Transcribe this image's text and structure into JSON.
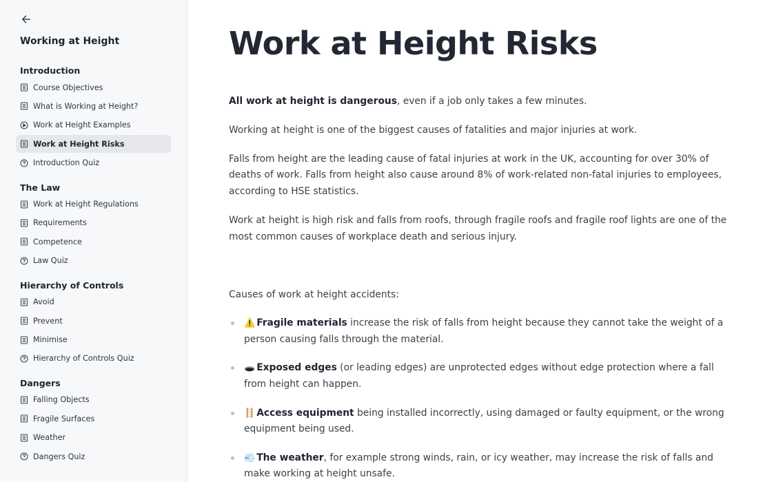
{
  "sidebar": {
    "course_title": "Working at Height",
    "sections": [
      {
        "title": "Introduction",
        "lessons": [
          {
            "label": "Course Objectives",
            "icon": "document-icon"
          },
          {
            "label": "What is Working at Height?",
            "icon": "document-icon"
          },
          {
            "label": "Work at Height Examples",
            "icon": "play-icon"
          },
          {
            "label": "Work at Height Risks",
            "icon": "document-icon",
            "active": true
          },
          {
            "label": "Introduction Quiz",
            "icon": "quiz-icon"
          }
        ]
      },
      {
        "title": "The Law",
        "lessons": [
          {
            "label": "Work at Height Regulations",
            "icon": "document-icon"
          },
          {
            "label": "Requirements",
            "icon": "document-icon"
          },
          {
            "label": "Competence",
            "icon": "document-icon"
          },
          {
            "label": "Law Quiz",
            "icon": "quiz-icon"
          }
        ]
      },
      {
        "title": "Hierarchy of Controls",
        "lessons": [
          {
            "label": "Avoid",
            "icon": "document-icon"
          },
          {
            "label": "Prevent",
            "icon": "document-icon"
          },
          {
            "label": "Minimise",
            "icon": "document-icon"
          },
          {
            "label": "Hierarchy of Controls Quiz",
            "icon": "quiz-icon"
          }
        ]
      },
      {
        "title": "Dangers",
        "lessons": [
          {
            "label": "Falling Objects",
            "icon": "document-icon"
          },
          {
            "label": "Fragile Surfaces",
            "icon": "document-icon"
          },
          {
            "label": "Weather",
            "icon": "document-icon"
          },
          {
            "label": "Dangers Quiz",
            "icon": "quiz-icon"
          }
        ]
      }
    ]
  },
  "main": {
    "title": "Work at Height Risks",
    "p1_bold": "All work at height is dangerous",
    "p1_rest": ", even if a job only takes a few minutes.",
    "p2": "Working at height is one of the biggest causes of fatalities and major injuries at work.",
    "p3": "Falls from height are the leading cause of fatal injuries at work in the UK, accounting for over 30% of deaths of work. Falls from height also cause around 8% of work-related non-fatal injuries to employees, according to HSE statistics.",
    "p4": "Work at height is high risk and falls from roofs, through fragile roofs and fragile roof lights are one of the most common causes of workplace death and serious injury.",
    "causes_intro": "Causes of work at height accidents:",
    "causes": [
      {
        "emoji": "⚠️",
        "bold": "Fragile materials",
        "text": " increase the risk of falls from height because they cannot take the weight of a person causing falls through the material."
      },
      {
        "emoji": "🕳️",
        "bold": "Exposed edges",
        "text": " (or leading edges) are unprotected edges without edge protection where a fall from height can happen."
      },
      {
        "emoji": "🪜",
        "bold": "Access equipment",
        "text": " being installed incorrectly, using damaged or faulty equipment, or the wrong equipment being used."
      },
      {
        "emoji": "💨",
        "bold": "The weather",
        "text": ", for example strong winds, rain, or icy weather, may increase the risk of falls and make working at height unsafe."
      }
    ]
  }
}
